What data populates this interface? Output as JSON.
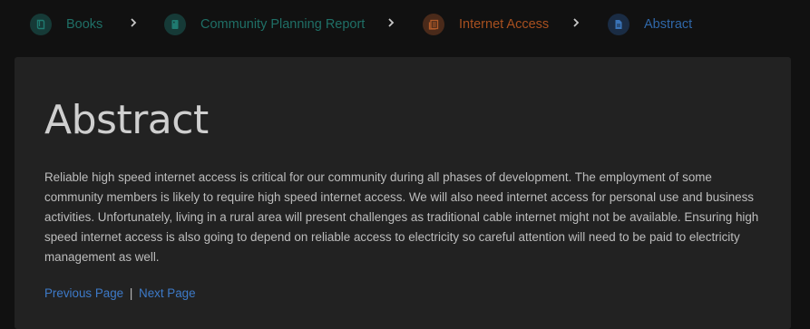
{
  "breadcrumb": {
    "items": [
      {
        "label": "Books",
        "icon": "book-icon",
        "text_color": "#1f6f66",
        "badge_color": "#163a37",
        "icon_color": "#1f7a70"
      },
      {
        "label": "Community Planning Report",
        "icon": "document-icon",
        "text_color": "#1f6f66",
        "badge_color": "#163a37",
        "icon_color": "#1f7a70"
      },
      {
        "label": "Internet Access",
        "icon": "chapter-icon",
        "text_color": "#a8501f",
        "badge_color": "#4a2a1a",
        "icon_color": "#b05a28"
      },
      {
        "label": "Abstract",
        "icon": "page-icon",
        "text_color": "#2f67a8",
        "badge_color": "#1a2c44",
        "icon_color": "#3a74b8"
      }
    ],
    "separator_icon": "chevron-right-icon"
  },
  "page": {
    "title": "Abstract",
    "body": "Reliable high speed internet access is critical for our community during all phases of development. The employment of some community members is likely to require high speed internet access. We will also need internet access for personal use and business activities. Unfortunately, living in a rural area will present challenges as traditional cable internet might not be available. Ensuring high speed internet access is also going to depend on reliable access to electricity so careful attention will need to be paid to electricity management as well."
  },
  "pager": {
    "previous_label": "Previous Page",
    "divider": "|",
    "next_label": "Next Page"
  },
  "colors": {
    "background": "#111111",
    "panel": "#222222",
    "link": "#3d7ac8",
    "text": "#bdbdbd",
    "title": "#cfcfcf"
  }
}
